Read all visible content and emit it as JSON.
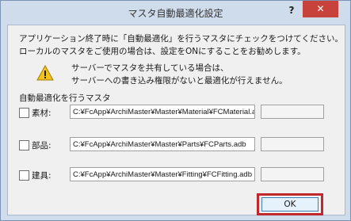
{
  "window": {
    "title": "マスタ自動最適化設定",
    "help_label": "?",
    "close_label": "✕"
  },
  "instructions": {
    "line1": "アプリケーション終了時に「自動最適化」を行うマスタにチェックをつけてください。",
    "line2": "ローカルのマスタをご使用の場合は、設定をONにすることをお勧めします。"
  },
  "warning": {
    "icon": "warning-icon",
    "line1": "サーバーでマスタを共有している場合は、",
    "line2": "サーバーへの書き込み権限がないと最適化が行えません。"
  },
  "section_label": "自動最適化を行うマスタ",
  "rows": [
    {
      "label": "素材:",
      "path": "C:¥FcApp¥ArchiMaster¥Master¥Material¥FCMaterial.adl",
      "checked": false
    },
    {
      "label": "部品:",
      "path": "C:¥FcApp¥ArchiMaster¥Master¥Parts¥FCParts.adb",
      "checked": false
    },
    {
      "label": "建具:",
      "path": "C:¥FcApp¥ArchiMaster¥Master¥Fitting¥FCFitting.adb",
      "checked": false
    }
  ],
  "ok_label": "OK",
  "colors": {
    "close_button": "#c7423a",
    "highlight": "#c0282d"
  }
}
